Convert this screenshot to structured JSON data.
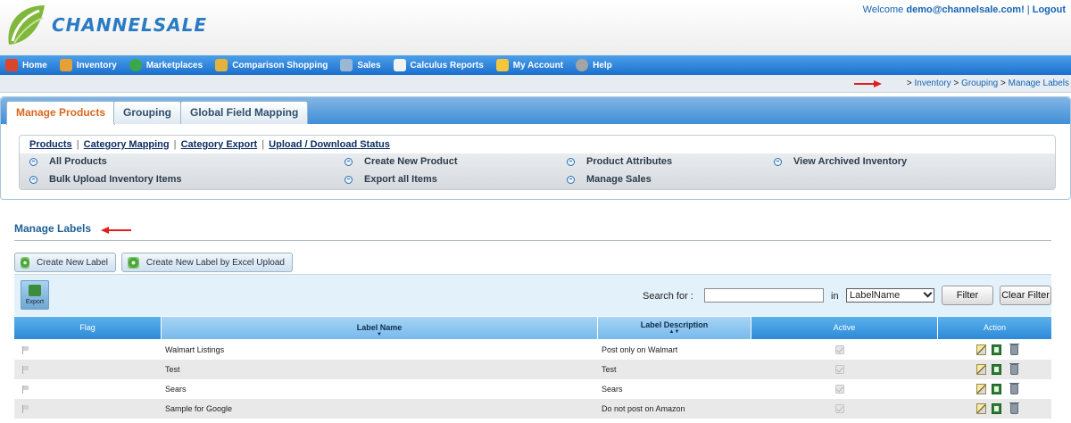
{
  "header": {
    "logo_text": "CHANNELSALE",
    "welcome_prefix": "Welcome ",
    "welcome_user": "demo@channelsale.com!",
    "welcome_sep": " | ",
    "logout": "Logout"
  },
  "nav": [
    {
      "label": "Home",
      "icon": "home-icon",
      "color": "#d9462b"
    },
    {
      "label": "Inventory",
      "icon": "inventory-icon",
      "color": "#e5a136"
    },
    {
      "label": "Marketplaces",
      "icon": "globe-icon",
      "color": "#3aa848"
    },
    {
      "label": "Comparison Shopping",
      "icon": "folder-icon",
      "color": "#e3b23c"
    },
    {
      "label": "Sales",
      "icon": "sales-icon",
      "color": "#9ab7d3"
    },
    {
      "label": "Calculus Reports",
      "icon": "chart-icon",
      "color": "#f2f2f2"
    },
    {
      "label": "My Account",
      "icon": "key-icon",
      "color": "#f3c63b"
    },
    {
      "label": "Help",
      "icon": "help-icon",
      "color": "#a4a4a4"
    }
  ],
  "breadcrumb": {
    "gt": "> ",
    "items": [
      "Inventory",
      "Grouping",
      "Manage Labels"
    ],
    "sep": " > "
  },
  "tabs": [
    "Manage Products",
    "Grouping",
    "Global Field Mapping"
  ],
  "sublinks": [
    "Products",
    "Category Mapping",
    "Category Export",
    "Upload / Download Status"
  ],
  "subitems": [
    "All Products",
    "Create New Product",
    "Product Attributes",
    "View Archived Inventory",
    "Bulk Upload Inventory Items",
    "Export all Items",
    "Manage Sales"
  ],
  "section": {
    "title": "Manage Labels"
  },
  "buttons": {
    "create_label": "Create New Label",
    "create_excel": "Create New Label by Excel Upload",
    "export": "Export",
    "filter": "Filter",
    "clear_filter": "Clear Filter"
  },
  "search": {
    "label": "Search for :",
    "value": "",
    "in_label": "in",
    "selected_field": "LabelName"
  },
  "table": {
    "headers": [
      "Flag",
      "Label Name",
      "Label Description",
      "Active",
      "Action"
    ],
    "rows": [
      {
        "name": "Walmart Listings",
        "description": "Post only on Walmart"
      },
      {
        "name": "Test",
        "description": "Test"
      },
      {
        "name": "Sears",
        "description": "Sears"
      },
      {
        "name": "Sample for Google",
        "description": "Do not post on Amazon"
      }
    ]
  },
  "colors": {
    "accent_orange": "#d9661f",
    "link_blue": "#1464b4",
    "arrow_red": "#e11d1d"
  }
}
